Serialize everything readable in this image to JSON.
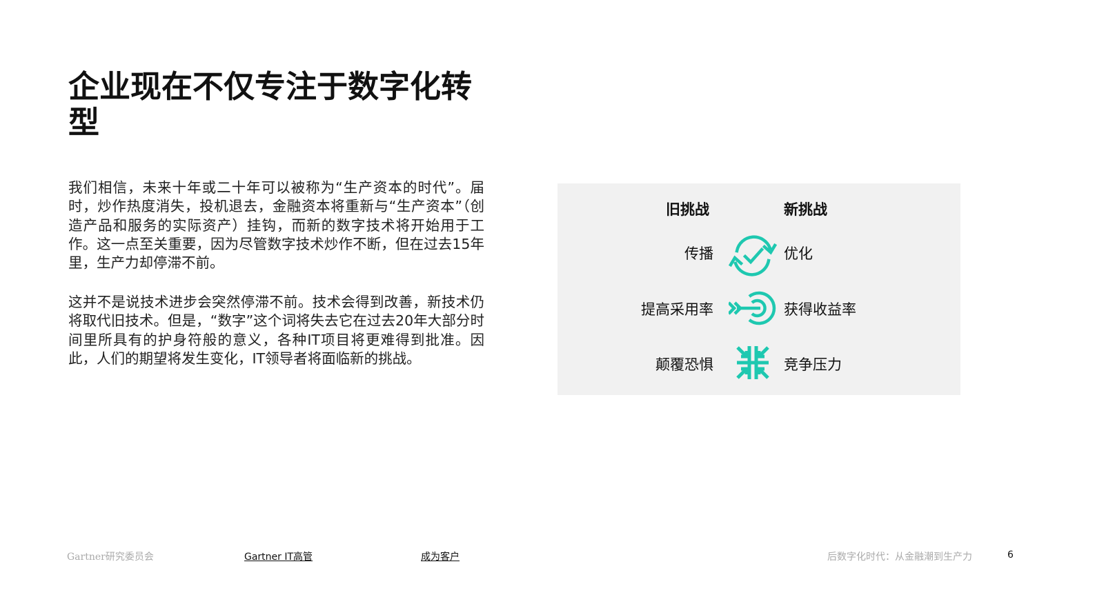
{
  "title": "企业现在不仅专注于数字化转型",
  "paragraphs": [
    "我们相信，未来十年或二十年可以被称为“生产资本的时代”。届时，炒作热度消失，投机退去，金融资本将重新与“生产资本”（创造产品和服务的实际资产）挂钩，而新的数字技术将开始用于工作。这一点至关重要，因为尽管数字技术炒作不断，但在过去15年里，生产力却停滞不前。",
    "这并不是说技术进步会突然停滞不前。技术会得到改善，新技术仍将取代旧技术。但是，“数字”这个词将失去它在过去20年大部分时间里所具有的护身符般的意义，各种IT项目将更难得到批准。因此，人们的期望将发生变化，IT领导者将面临新的挑战。"
  ],
  "panel": {
    "old_header": "旧挑战",
    "new_header": "新挑战",
    "rows": [
      {
        "old": "传播",
        "new": "优化",
        "icon": "refresh-check-icon"
      },
      {
        "old": "提高采用率",
        "new": "获得收益率",
        "icon": "target-arrow-icon"
      },
      {
        "old": "颠覆恐惧",
        "new": "竞争压力",
        "icon": "converge-arrows-icon"
      }
    ],
    "accent": "#1ec8b0"
  },
  "footer": {
    "brand": "Gartner研究委员会",
    "link1": "Gartner IT高管",
    "link2": "成为客户",
    "doc_title": "后数字化时代：从金融潮到生产力",
    "page": "6"
  }
}
